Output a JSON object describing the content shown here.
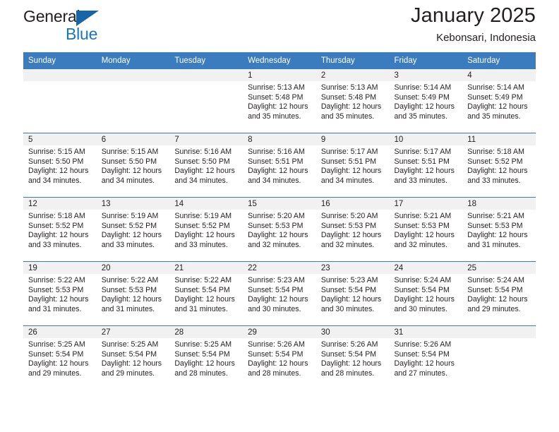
{
  "brand": {
    "name_top": "General",
    "name_bottom": "Blue",
    "accent_color": "#1b75bb",
    "triangle_color": "#1565a8"
  },
  "header": {
    "title": "January 2025",
    "subtitle": "Kebonsari, Indonesia"
  },
  "calendar": {
    "header_bg": "#3a7cbe",
    "header_text_color": "#ffffff",
    "daynum_band_bg": "#f1f1f1",
    "weekday_headers": [
      "Sunday",
      "Monday",
      "Tuesday",
      "Wednesday",
      "Thursday",
      "Friday",
      "Saturday"
    ],
    "weeks": [
      [
        {
          "day": "",
          "sunrise": "",
          "sunset": "",
          "daylight_line1": "",
          "daylight_line2": ""
        },
        {
          "day": "",
          "sunrise": "",
          "sunset": "",
          "daylight_line1": "",
          "daylight_line2": ""
        },
        {
          "day": "",
          "sunrise": "",
          "sunset": "",
          "daylight_line1": "",
          "daylight_line2": ""
        },
        {
          "day": "1",
          "sunrise": "Sunrise: 5:13 AM",
          "sunset": "Sunset: 5:48 PM",
          "daylight_line1": "Daylight: 12 hours",
          "daylight_line2": "and 35 minutes."
        },
        {
          "day": "2",
          "sunrise": "Sunrise: 5:13 AM",
          "sunset": "Sunset: 5:48 PM",
          "daylight_line1": "Daylight: 12 hours",
          "daylight_line2": "and 35 minutes."
        },
        {
          "day": "3",
          "sunrise": "Sunrise: 5:14 AM",
          "sunset": "Sunset: 5:49 PM",
          "daylight_line1": "Daylight: 12 hours",
          "daylight_line2": "and 35 minutes."
        },
        {
          "day": "4",
          "sunrise": "Sunrise: 5:14 AM",
          "sunset": "Sunset: 5:49 PM",
          "daylight_line1": "Daylight: 12 hours",
          "daylight_line2": "and 35 minutes."
        }
      ],
      [
        {
          "day": "5",
          "sunrise": "Sunrise: 5:15 AM",
          "sunset": "Sunset: 5:50 PM",
          "daylight_line1": "Daylight: 12 hours",
          "daylight_line2": "and 34 minutes."
        },
        {
          "day": "6",
          "sunrise": "Sunrise: 5:15 AM",
          "sunset": "Sunset: 5:50 PM",
          "daylight_line1": "Daylight: 12 hours",
          "daylight_line2": "and 34 minutes."
        },
        {
          "day": "7",
          "sunrise": "Sunrise: 5:16 AM",
          "sunset": "Sunset: 5:50 PM",
          "daylight_line1": "Daylight: 12 hours",
          "daylight_line2": "and 34 minutes."
        },
        {
          "day": "8",
          "sunrise": "Sunrise: 5:16 AM",
          "sunset": "Sunset: 5:51 PM",
          "daylight_line1": "Daylight: 12 hours",
          "daylight_line2": "and 34 minutes."
        },
        {
          "day": "9",
          "sunrise": "Sunrise: 5:17 AM",
          "sunset": "Sunset: 5:51 PM",
          "daylight_line1": "Daylight: 12 hours",
          "daylight_line2": "and 34 minutes."
        },
        {
          "day": "10",
          "sunrise": "Sunrise: 5:17 AM",
          "sunset": "Sunset: 5:51 PM",
          "daylight_line1": "Daylight: 12 hours",
          "daylight_line2": "and 33 minutes."
        },
        {
          "day": "11",
          "sunrise": "Sunrise: 5:18 AM",
          "sunset": "Sunset: 5:52 PM",
          "daylight_line1": "Daylight: 12 hours",
          "daylight_line2": "and 33 minutes."
        }
      ],
      [
        {
          "day": "12",
          "sunrise": "Sunrise: 5:18 AM",
          "sunset": "Sunset: 5:52 PM",
          "daylight_line1": "Daylight: 12 hours",
          "daylight_line2": "and 33 minutes."
        },
        {
          "day": "13",
          "sunrise": "Sunrise: 5:19 AM",
          "sunset": "Sunset: 5:52 PM",
          "daylight_line1": "Daylight: 12 hours",
          "daylight_line2": "and 33 minutes."
        },
        {
          "day": "14",
          "sunrise": "Sunrise: 5:19 AM",
          "sunset": "Sunset: 5:52 PM",
          "daylight_line1": "Daylight: 12 hours",
          "daylight_line2": "and 33 minutes."
        },
        {
          "day": "15",
          "sunrise": "Sunrise: 5:20 AM",
          "sunset": "Sunset: 5:53 PM",
          "daylight_line1": "Daylight: 12 hours",
          "daylight_line2": "and 32 minutes."
        },
        {
          "day": "16",
          "sunrise": "Sunrise: 5:20 AM",
          "sunset": "Sunset: 5:53 PM",
          "daylight_line1": "Daylight: 12 hours",
          "daylight_line2": "and 32 minutes."
        },
        {
          "day": "17",
          "sunrise": "Sunrise: 5:21 AM",
          "sunset": "Sunset: 5:53 PM",
          "daylight_line1": "Daylight: 12 hours",
          "daylight_line2": "and 32 minutes."
        },
        {
          "day": "18",
          "sunrise": "Sunrise: 5:21 AM",
          "sunset": "Sunset: 5:53 PM",
          "daylight_line1": "Daylight: 12 hours",
          "daylight_line2": "and 31 minutes."
        }
      ],
      [
        {
          "day": "19",
          "sunrise": "Sunrise: 5:22 AM",
          "sunset": "Sunset: 5:53 PM",
          "daylight_line1": "Daylight: 12 hours",
          "daylight_line2": "and 31 minutes."
        },
        {
          "day": "20",
          "sunrise": "Sunrise: 5:22 AM",
          "sunset": "Sunset: 5:53 PM",
          "daylight_line1": "Daylight: 12 hours",
          "daylight_line2": "and 31 minutes."
        },
        {
          "day": "21",
          "sunrise": "Sunrise: 5:22 AM",
          "sunset": "Sunset: 5:54 PM",
          "daylight_line1": "Daylight: 12 hours",
          "daylight_line2": "and 31 minutes."
        },
        {
          "day": "22",
          "sunrise": "Sunrise: 5:23 AM",
          "sunset": "Sunset: 5:54 PM",
          "daylight_line1": "Daylight: 12 hours",
          "daylight_line2": "and 30 minutes."
        },
        {
          "day": "23",
          "sunrise": "Sunrise: 5:23 AM",
          "sunset": "Sunset: 5:54 PM",
          "daylight_line1": "Daylight: 12 hours",
          "daylight_line2": "and 30 minutes."
        },
        {
          "day": "24",
          "sunrise": "Sunrise: 5:24 AM",
          "sunset": "Sunset: 5:54 PM",
          "daylight_line1": "Daylight: 12 hours",
          "daylight_line2": "and 30 minutes."
        },
        {
          "day": "25",
          "sunrise": "Sunrise: 5:24 AM",
          "sunset": "Sunset: 5:54 PM",
          "daylight_line1": "Daylight: 12 hours",
          "daylight_line2": "and 29 minutes."
        }
      ],
      [
        {
          "day": "26",
          "sunrise": "Sunrise: 5:25 AM",
          "sunset": "Sunset: 5:54 PM",
          "daylight_line1": "Daylight: 12 hours",
          "daylight_line2": "and 29 minutes."
        },
        {
          "day": "27",
          "sunrise": "Sunrise: 5:25 AM",
          "sunset": "Sunset: 5:54 PM",
          "daylight_line1": "Daylight: 12 hours",
          "daylight_line2": "and 29 minutes."
        },
        {
          "day": "28",
          "sunrise": "Sunrise: 5:25 AM",
          "sunset": "Sunset: 5:54 PM",
          "daylight_line1": "Daylight: 12 hours",
          "daylight_line2": "and 28 minutes."
        },
        {
          "day": "29",
          "sunrise": "Sunrise: 5:26 AM",
          "sunset": "Sunset: 5:54 PM",
          "daylight_line1": "Daylight: 12 hours",
          "daylight_line2": "and 28 minutes."
        },
        {
          "day": "30",
          "sunrise": "Sunrise: 5:26 AM",
          "sunset": "Sunset: 5:54 PM",
          "daylight_line1": "Daylight: 12 hours",
          "daylight_line2": "and 28 minutes."
        },
        {
          "day": "31",
          "sunrise": "Sunrise: 5:26 AM",
          "sunset": "Sunset: 5:54 PM",
          "daylight_line1": "Daylight: 12 hours",
          "daylight_line2": "and 27 minutes."
        },
        {
          "day": "",
          "sunrise": "",
          "sunset": "",
          "daylight_line1": "",
          "daylight_line2": ""
        }
      ]
    ]
  }
}
